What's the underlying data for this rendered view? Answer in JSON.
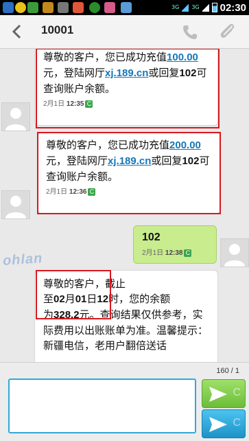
{
  "status_bar": {
    "time": "02:30",
    "net_1": "3G",
    "net_2": "3G"
  },
  "header": {
    "contact": "10001"
  },
  "messages": [
    {
      "text_a": "尊敬的客户，您已成功充值",
      "amount": "100.00",
      "text_b": "元，登陆网厅",
      "link": "xj.189.cn",
      "text_c": "或回复",
      "code": "102",
      "text_d": "可查询账户余额。",
      "date": "2月1日",
      "time": "12:35",
      "badge": "C"
    },
    {
      "text_a": "尊敬的客户，您已成功充值",
      "amount": "200.00",
      "text_b": "元，登陆网厅",
      "link": "xj.189.cn",
      "text_c": "或回复",
      "code": "102",
      "text_d": "可查询账户余额。",
      "date": "2月1日",
      "time": "12:36",
      "badge": "C"
    },
    {
      "text": "102",
      "date": "2月1日",
      "time": "12:38",
      "badge": "C"
    },
    {
      "line_1": "尊敬的客户，截止",
      "line_2a": "至",
      "month": "02",
      "line_2b": "月",
      "day": "01",
      "line_2c": "日",
      "hour": "12",
      "line_2d": "时，您的余额",
      "line_3a": "为",
      "balance": "328.2",
      "line_3b": "元。查询结果仅供参考，实际费用以出账账单为准。温馨提示：新疆电信，老用户翻倍送话"
    }
  ],
  "watermark": "ohlan",
  "compose": {
    "counter": "160 / 1",
    "placeholder": "",
    "send_letter": "C"
  },
  "colors": {
    "highlight": "#d8181f",
    "link": "#1477b8",
    "outgoing_bubble": "#c8ec8e"
  }
}
